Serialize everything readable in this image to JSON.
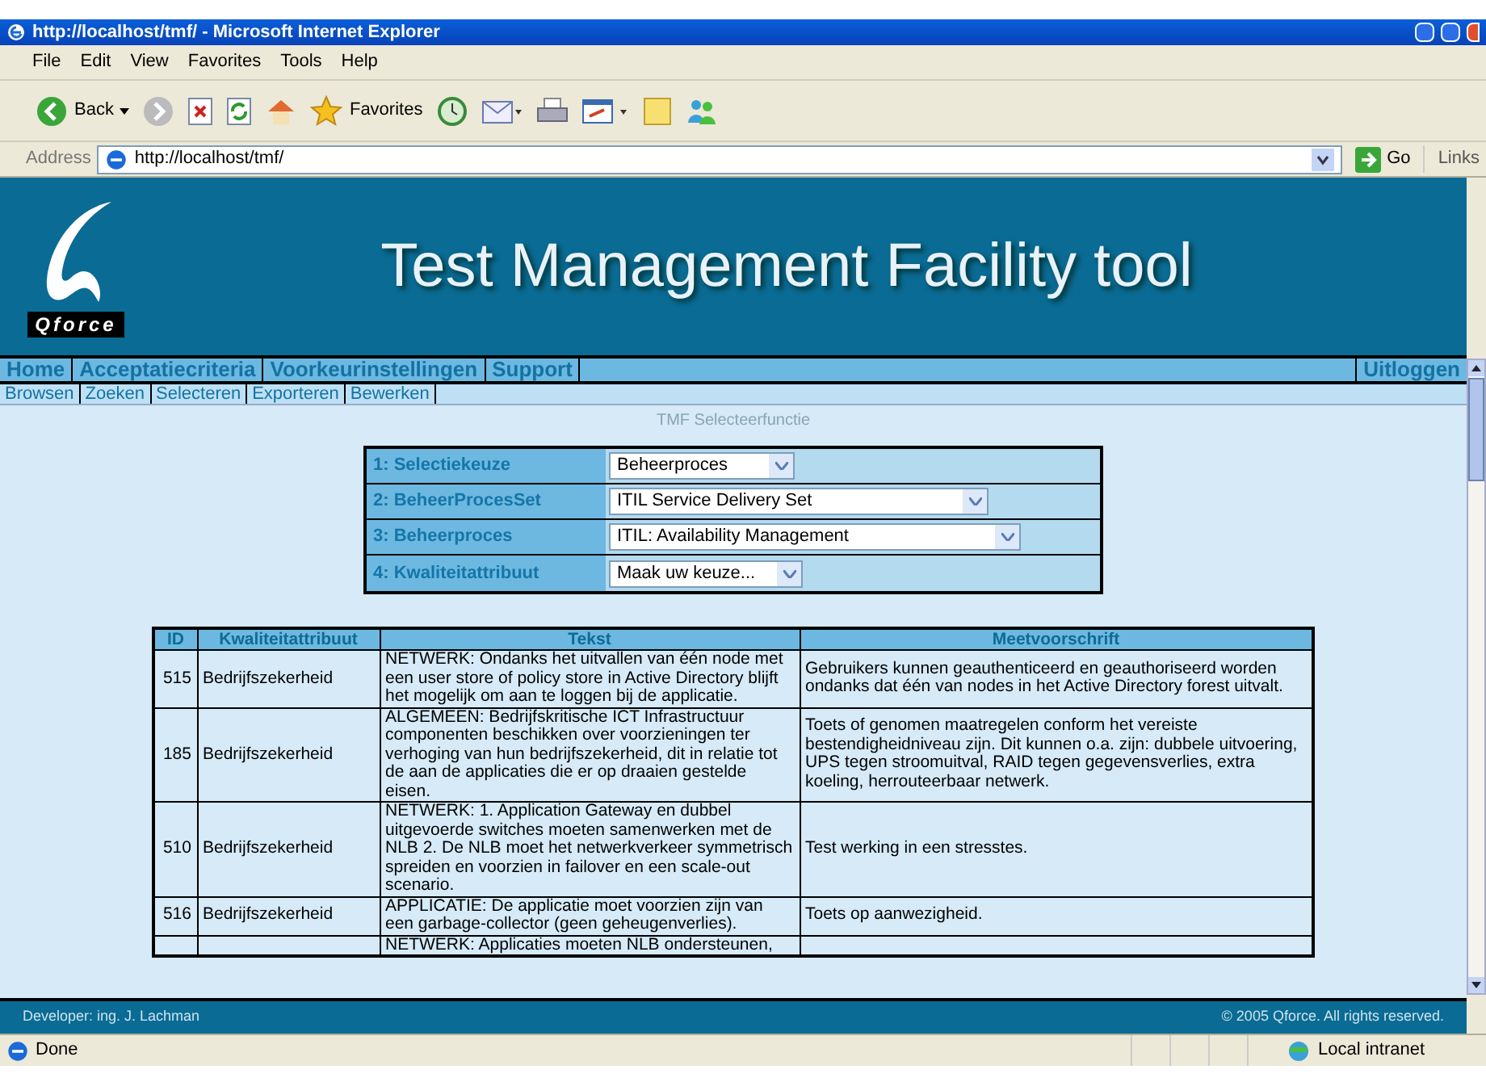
{
  "window": {
    "title": "http://localhost/tmf/ - Microsoft Internet Explorer"
  },
  "menu_bar": [
    "File",
    "Edit",
    "View",
    "Favorites",
    "Tools",
    "Help"
  ],
  "toolbar": {
    "back": "Back",
    "favorites": "Favorites"
  },
  "address_bar": {
    "label": "Address",
    "url": "http://localhost/tmf/",
    "go": "Go",
    "links": "Links"
  },
  "header": {
    "logo_text": "Qforce",
    "title": "Test Management Facility tool"
  },
  "nav": {
    "items": [
      "Home",
      "Acceptatiecriteria",
      "Voorkeurinstellingen",
      "Support"
    ],
    "logout": "Uitloggen"
  },
  "subnav": [
    "Browsen",
    "Zoeken",
    "Selecteren",
    "Exporteren",
    "Bewerken"
  ],
  "section_title": "TMF Selecteerfunctie",
  "form": [
    {
      "label": "1: Selectiekeuze",
      "value": "Beheerproces"
    },
    {
      "label": "2: BeheerProcesSet",
      "value": "ITIL Service Delivery Set"
    },
    {
      "label": "3: Beheerproces",
      "value": "ITIL: Availability Management"
    },
    {
      "label": "4: Kwaliteitattribuut",
      "value": "Maak uw keuze..."
    }
  ],
  "results": {
    "columns": [
      "ID",
      "Kwaliteitattribuut",
      "Tekst",
      "Meetvoorschrift"
    ],
    "rows": [
      {
        "id": "515",
        "attribute": "Bedrijfszekerheid",
        "text": "NETWERK: Ondanks het uitvallen van één node met een user store of policy store in Active Directory blijft het mogelijk om aan te loggen bij de applicatie.",
        "rule": "Gebruikers kunnen geauthenticeerd en geauthoriseerd worden ondanks dat één van nodes in het Active Directory forest uitvalt."
      },
      {
        "id": "185",
        "attribute": "Bedrijfszekerheid",
        "text": "ALGEMEEN: Bedrijfskritische ICT Infrastructuur componenten beschikken over voorzieningen ter verhoging van hun bedrijfszekerheid, dit in relatie tot de aan de applicaties die er op draaien gestelde eisen.",
        "rule": "Toets of genomen maatregelen conform het vereiste bestendigheidniveau zijn. Dit kunnen o.a. zijn: dubbele uitvoering, UPS tegen stroomuitval, RAID tegen gegevensverlies, extra koeling, herrouteerbaar netwerk."
      },
      {
        "id": "510",
        "attribute": "Bedrijfszekerheid",
        "text": "NETWERK: 1. Application Gateway en dubbel uitgevoerde switches moeten samenwerken met de NLB 2. De NLB moet het netwerkverkeer symmetrisch spreiden en voorzien in failover en een scale-out scenario.",
        "rule": "Test werking in een stresstes."
      },
      {
        "id": "516",
        "attribute": "Bedrijfszekerheid",
        "text": "APPLICATIE: De applicatie moet voorzien zijn van een garbage-collector (geen geheugenverlies).",
        "rule": "Toets op aanwezigheid."
      },
      {
        "text": "NETWERK: Applicaties moeten NLB ondersteunen,"
      }
    ]
  },
  "footer": {
    "developer": "Developer: ing. J. Lachman",
    "copyright": "© 2005 Qforce. All rights reserved."
  },
  "status_bar": {
    "status": "Done",
    "zone": "Local intranet"
  }
}
